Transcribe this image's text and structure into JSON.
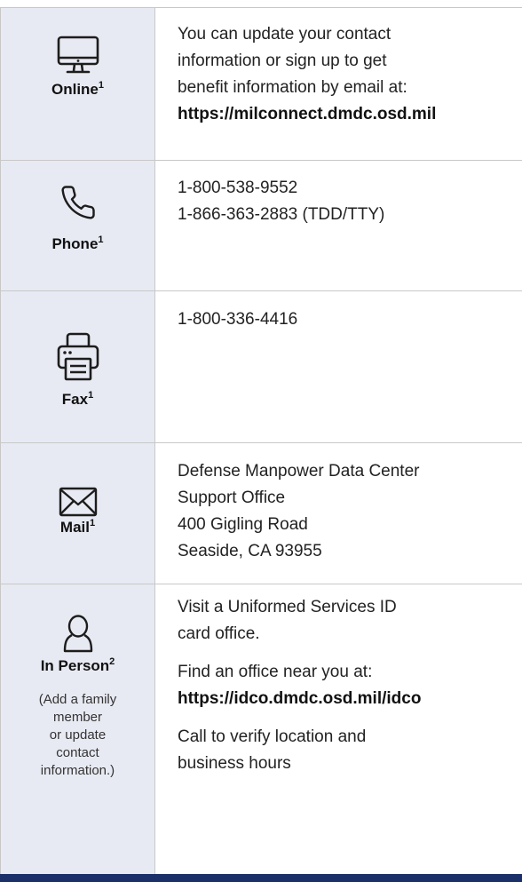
{
  "rows": [
    {
      "label": "Online",
      "sup": "1",
      "icon": "monitor-icon",
      "lines": [
        "You can update your contact",
        "information or sign up to get",
        "benefit information by email at:"
      ],
      "link": "https://milconnect.dmdc.osd.mil"
    },
    {
      "label": "Phone",
      "sup": "1",
      "icon": "phone-icon",
      "lines": [
        "1-800-538-9552",
        "1-866-363-2883 (TDD/TTY)"
      ]
    },
    {
      "label": "Fax",
      "sup": "1",
      "icon": "fax-icon",
      "lines": [
        "1-800-336-4416"
      ]
    },
    {
      "label": "Mail",
      "sup": "1",
      "icon": "envelope-icon",
      "lines": [
        "Defense Manpower Data Center",
        "Support Office",
        "400 Gigling Road",
        "Seaside, CA 93955"
      ]
    },
    {
      "label": "In Person",
      "sup": "2",
      "icon": "person-icon",
      "note_lines": [
        "(Add a family",
        "member",
        "or update",
        "contact",
        "information.)"
      ],
      "para1": [
        "Visit a Uniformed Services ID",
        "card office."
      ],
      "para2": "Find an office near you at:",
      "link": "https://idco.dmdc.osd.mil/idco",
      "para3": [
        "Call to verify location and",
        "business hours"
      ]
    }
  ],
  "colors": {
    "icon_cell_bg": "#e8eaf3",
    "border": "#c8c8c8",
    "bottom_bar": "#1b3068"
  }
}
